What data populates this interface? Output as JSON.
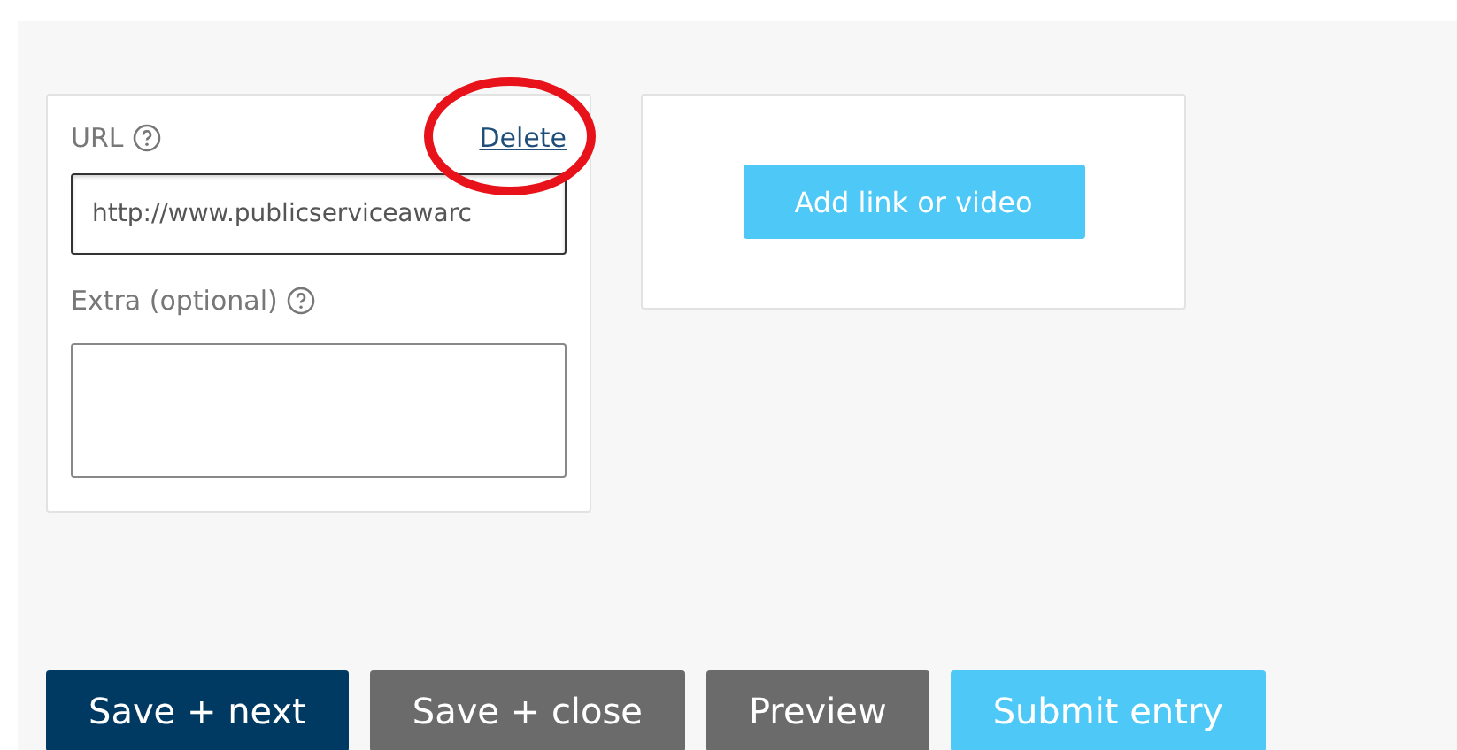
{
  "link_card": {
    "url_label": "URL",
    "delete_link": "Delete",
    "url_value": "http://www.publicserviceawarc",
    "extra_label": "Extra (optional)"
  },
  "add_card": {
    "button": "Add link or video"
  },
  "buttons": [
    {
      "label": "Save + next",
      "kind": "primary"
    },
    {
      "label": "Save + close",
      "kind": "secondary"
    },
    {
      "label": "Preview",
      "kind": "secondary"
    },
    {
      "label": "Submit entry",
      "kind": "submit"
    }
  ]
}
